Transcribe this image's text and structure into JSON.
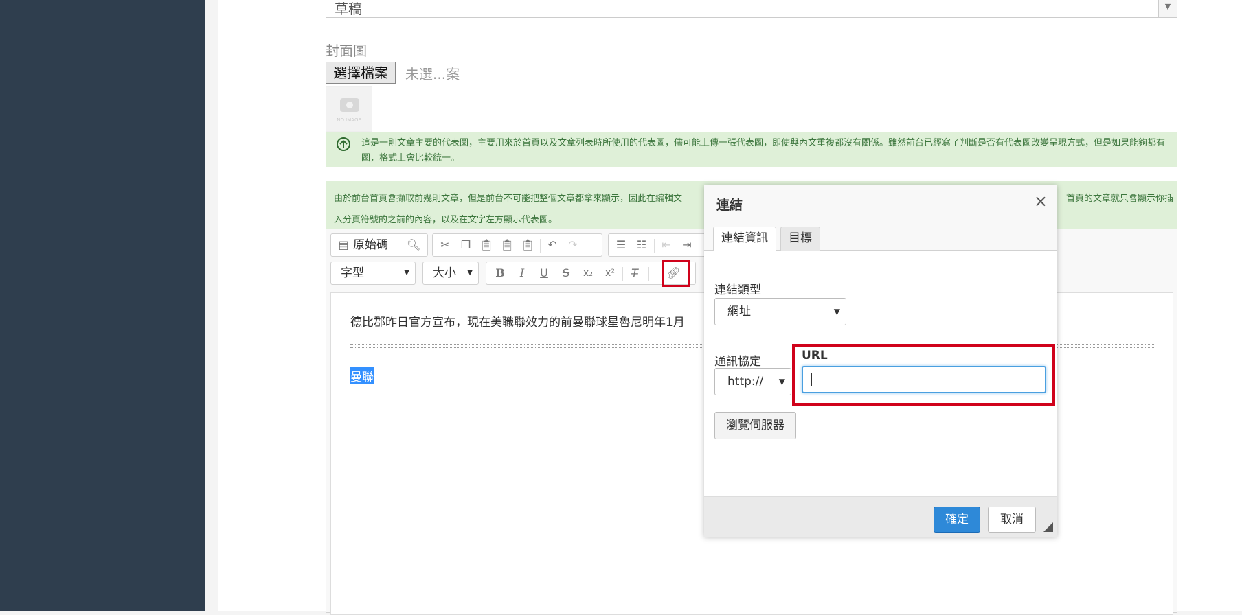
{
  "form": {
    "status_value": "草稿",
    "cover_label": "封面圖",
    "file_button": "選擇檔案",
    "file_status": "未選...案",
    "no_image": "NO IMAGE",
    "note1": "這是一則文章主要的代表圖，主要用來於首頁以及文章列表時所使用的代表圖，儘可能上傳一張代表圖，即使與內文重複都沒有關係。雖然前台已經寫了判斷是否有代表圖改變呈現方式，但是如果能夠都有圖，格式上會比較統一。",
    "note2_left": "由於前台首頁會擷取前幾則文章，但是前台不可能把整個文章都拿來顯示，因此在編輯文",
    "note2_right": "首頁的文章就只會顯示你插",
    "note2_line2": "入分頁符號的之前的內容，以及在文字左方顯示代表圖。"
  },
  "editor": {
    "source_label": "原始碼",
    "font_combo": "字型",
    "size_combo": "大小",
    "paragraph": "德比郡昨日官方宣布，現在美職聯效力的前曼聯球星魯尼明年1月",
    "selected_text": "曼聯"
  },
  "dialog": {
    "title": "連結",
    "close": "×",
    "tabs": [
      "連結資訊",
      "目標"
    ],
    "link_type_label": "連結類型",
    "link_type_value": "網址",
    "protocol_label": "通訊協定",
    "protocol_value": "http://",
    "url_label": "URL",
    "url_value": "",
    "browse_button": "瀏覽伺服器",
    "ok_button": "確定",
    "cancel_button": "取消"
  },
  "colors": {
    "sidebar": "#2f3e4e",
    "note_bg": "#dff0d8",
    "note_text": "#3c763d",
    "highlight": "#d0021b",
    "primary": "#2e89d8"
  }
}
